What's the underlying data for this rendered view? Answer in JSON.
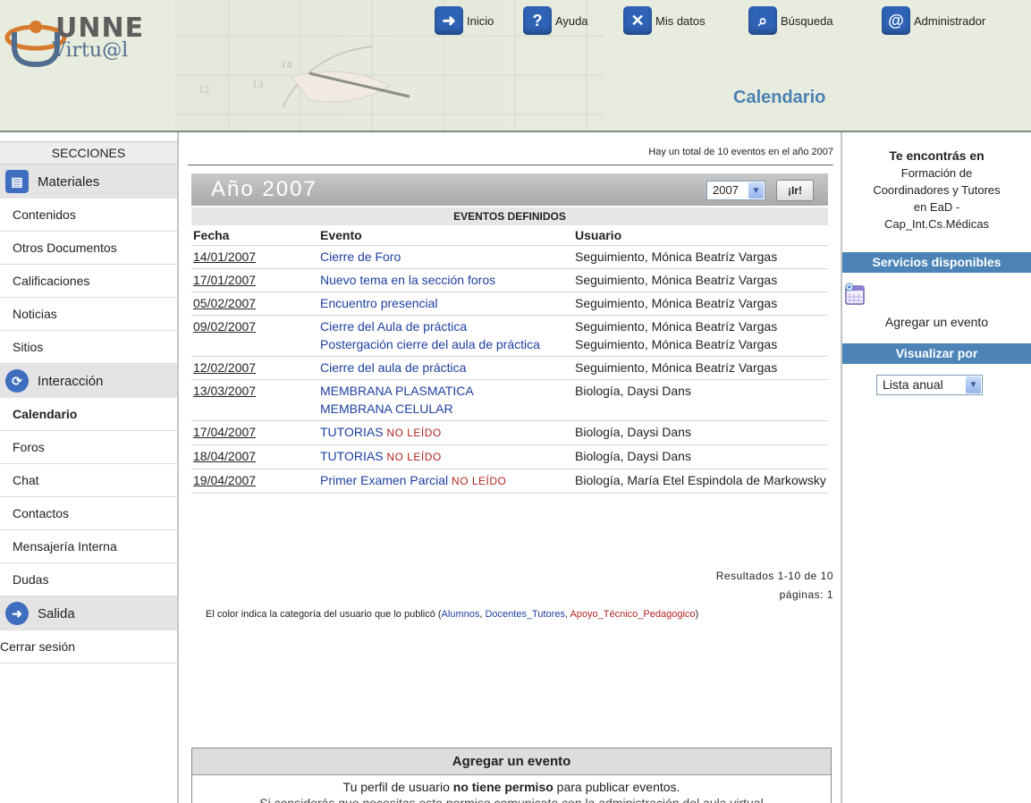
{
  "logo": {
    "line1": "UNNE",
    "line2": "Virtu@l"
  },
  "topnav": [
    {
      "label": "Inicio",
      "icon": "arrow-icon",
      "color": "#2f63b5"
    },
    {
      "label": "Ayuda",
      "icon": "help-icon",
      "color": "#2f63b5"
    },
    {
      "label": "Mis datos",
      "icon": "tools-icon",
      "color": "#2f63b5"
    },
    {
      "label": "Búsqueda",
      "icon": "search-icon",
      "color": "#2f63b5"
    },
    {
      "label": "Administrador",
      "icon": "at-icon",
      "color": "#2f63b5"
    }
  ],
  "page_heading": "Calendario",
  "sidebar": {
    "header": "SECCIONES",
    "materiales": {
      "title": "Materiales",
      "items": [
        "Contenidos",
        "Otros Documentos",
        "Calificaciones",
        "Noticias",
        "Sitios"
      ]
    },
    "interaccion": {
      "title": "Interacción",
      "items": [
        "Calendario",
        "Foros",
        "Chat",
        "Contactos",
        "Mensajería Interna",
        "Dudas"
      ]
    },
    "salida": {
      "title": "Salida",
      "items": [
        "Cerrar sesión"
      ]
    }
  },
  "main": {
    "total_text": "Hay un total de 10 eventos en el año 2007",
    "year_title": "Año 2007",
    "year_select": "2007",
    "go_label": "¡Ir!",
    "events_title": "EVENTOS DEFINIDOS",
    "columns": [
      "Fecha",
      "Evento",
      "Usuario"
    ],
    "rows": [
      {
        "date": "14/01/2007",
        "events": [
          {
            "text": "Cierre de Foro"
          }
        ],
        "users": [
          "Seguimiento, Mónica Beatríz Vargas"
        ]
      },
      {
        "date": "17/01/2007",
        "events": [
          {
            "text": "Nuevo tema en la sección foros"
          }
        ],
        "users": [
          "Seguimiento, Mónica Beatríz Vargas"
        ]
      },
      {
        "date": "05/02/2007",
        "events": [
          {
            "text": "Encuentro presencial"
          }
        ],
        "users": [
          "Seguimiento, Mónica Beatríz Vargas"
        ]
      },
      {
        "date": "09/02/2007",
        "events": [
          {
            "text": "Cierre del Aula de práctica"
          },
          {
            "text": "Postergación cierre del aula de práctica"
          }
        ],
        "users": [
          "Seguimiento, Mónica Beatríz Vargas",
          "Seguimiento, Mónica Beatríz Vargas"
        ]
      },
      {
        "date": "12/02/2007",
        "events": [
          {
            "text": "Cierre del aula de práctica"
          }
        ],
        "users": [
          "Seguimiento, Mónica Beatríz Vargas"
        ]
      },
      {
        "date": "13/03/2007",
        "events": [
          {
            "text": "MEMBRANA PLASMATICA"
          },
          {
            "text": "MEMBRANA CELULAR"
          }
        ],
        "users": [
          "Biología, Daysi Dans"
        ]
      },
      {
        "date": "17/04/2007",
        "events": [
          {
            "text": "TUTORIAS",
            "flag": "NO LEÍDO"
          }
        ],
        "users": [
          "Biología, Daysi Dans"
        ]
      },
      {
        "date": "18/04/2007",
        "events": [
          {
            "text": "TUTORIAS",
            "flag": "NO LEÍDO"
          }
        ],
        "users": [
          "Biología, Daysi Dans"
        ]
      },
      {
        "date": "19/04/2007",
        "events": [
          {
            "text": "Primer Examen Parcial",
            "flag": "NO LEÍDO"
          }
        ],
        "users": [
          "Biología, María Etel Espindola de Markowsky"
        ]
      }
    ],
    "results_line1": "Resultados 1-10 de 10",
    "results_line2": "páginas: 1",
    "legend_prefix": "El color indica la categoría del usuario que lo publicó (",
    "legend_alumnos": "Alumnos",
    "legend_docentes": "Docentes_Tutores",
    "legend_apoyo": "Apoyo_Técnico_Pedagogico",
    "legend_suffix": ")",
    "add_box": {
      "title": "Agregar un evento",
      "text_pre": "Tu perfil de usuario ",
      "text_bold": "no tiene permiso",
      "text_post": " para publicar eventos.",
      "cut_line": "Si considerás que necesitas este permiso comunicate con la administración del aula virtual"
    }
  },
  "right": {
    "location_title": "Te encontrás en",
    "location_lines": [
      "Formación de",
      "Coordinadores y Tutores",
      "en EaD -",
      "Cap_Int.Cs.Médicas"
    ],
    "services_title": "Servicios disponibles",
    "add_event": "Agregar un evento",
    "view_title": "Visualizar por",
    "view_select": "Lista anual"
  },
  "colors": {
    "accent": "#4d84b8",
    "event_link": "#1d3fa0",
    "unread": "#b3241f",
    "header_bg": "#e8ecde"
  }
}
